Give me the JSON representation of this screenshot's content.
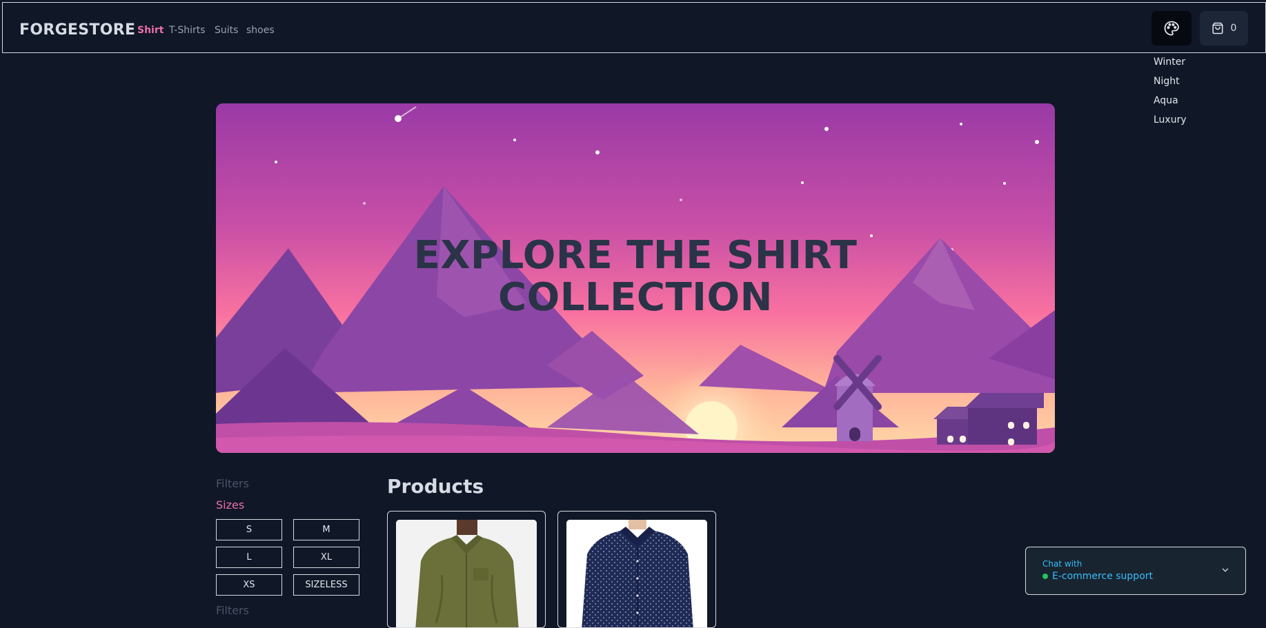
{
  "header": {
    "brand": "FORGESTORE",
    "nav": [
      {
        "label": "Shirt",
        "active": true
      },
      {
        "label": "T-Shirts",
        "active": false
      },
      {
        "label": "Suits",
        "active": false
      },
      {
        "label": "shoes",
        "active": false
      }
    ],
    "theme_icon": "palette-icon",
    "cart_icon": "shopping-bag-icon",
    "cart_count": "0"
  },
  "theme_menu": {
    "items": [
      "Winter",
      "Night",
      "Aqua",
      "Luxury"
    ]
  },
  "hero": {
    "title_line1": "EXPLORE THE SHIRT",
    "title_line2": "COLLECTION"
  },
  "filters": {
    "heading": "Filters",
    "sizes_heading": "Sizes",
    "sizes": [
      "S",
      "M",
      "L",
      "XL",
      "XS",
      "SIZELESS"
    ],
    "heading_2": "Filters"
  },
  "products": {
    "title": "Products",
    "items": [
      {
        "image": "olive-green-shirt"
      },
      {
        "image": "navy-polka-dot-shirt"
      }
    ]
  },
  "chat": {
    "label": "Chat with",
    "name": "E-commerce support",
    "status_color": "#22c55e",
    "chevron_icon": "chevron-down-icon"
  },
  "colors": {
    "background": "#101727",
    "accent": "#ec6fa9",
    "chat_text": "#38bdf8"
  }
}
